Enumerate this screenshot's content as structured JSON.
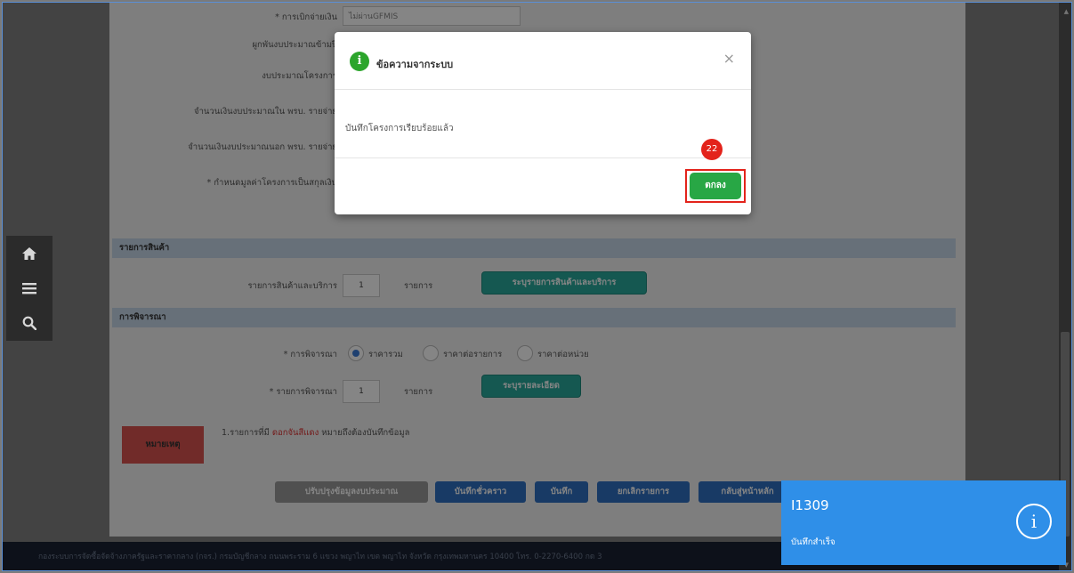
{
  "form": {
    "select_label": "* การเบิกจ่ายเงิน",
    "select_value": "ไม่ผ่านGFMIS",
    "labels": [
      "ผูกพันงบประมาณข้ามปี",
      "งบประมาณโครงการ",
      "จำนวนเงินงบประมาณใน พรบ. รายจ่าย",
      "จำนวนเงินงบประมาณนอก พรบ. รายจ่าย",
      "* กำหนดมูลค่าโครงการเป็นสกุลเงิน"
    ],
    "section_items": "รายการสินค้า",
    "items_label": "รายการสินค้าและบริการ",
    "items_count": "1",
    "items_unit": "รายการ",
    "items_button": "ระบุรายการสินค้าและบริการ",
    "section_consider": "การพิจารณา",
    "consider_label": "* การพิจารณา",
    "consider_options": [
      "ราคารวม",
      "ราคาต่อรายการ",
      "ราคาต่อหน่วย"
    ],
    "consider_items_label": "* รายการพิจารณา",
    "consider_items_count": "1",
    "consider_items_unit": "รายการ",
    "detail_button": "ระบุรายละเอียด",
    "note_label": "หมายเหตุ",
    "note_prefix": "1.รายการที่มี",
    "note_red": "ดอกจันสีแดง",
    "note_suffix": "หมายถึงต้องบันทึกข้อมูล",
    "buttons": {
      "update_budget": "ปรับปรุงข้อมูลงบประมาณ",
      "save_draft": "บันทึกชั่วคราว",
      "save": "บันทึก",
      "cancel": "ยกเลิกรายการ",
      "back": "กลับสู่หน้าหลัก"
    }
  },
  "footer": {
    "text": "กองระบบการจัดซื้อจัดจ้างภาครัฐและราคากลาง (กจร.) กรมบัญชีกลาง ถนนพระราม 6 แขวง พญาไท เขต พญาไท จังหวัด กรุงเทพมหานคร 10400 โทร. 0-2270-6400 กด 3"
  },
  "modal": {
    "title": "ข้อความจากระบบ",
    "close": "×",
    "message": "บันทึกโครงการเรียบร้อยแล้ว",
    "ok_label": "ตกลง",
    "step": "22"
  },
  "toast": {
    "code": "I1309",
    "message": "บันทึกสำเร็จ",
    "icon": "info-icon"
  },
  "colors": {
    "ok_button": "#28a745",
    "highlight": "#e3231b",
    "toast": "#2f8fe8",
    "section_bar": "#c6d7e8",
    "teal_button": "#2aa99b"
  }
}
